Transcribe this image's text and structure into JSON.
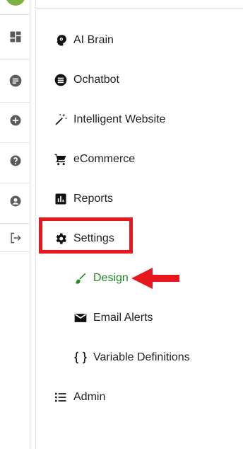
{
  "rail": {
    "items": [
      {
        "icon": "dashboard-icon"
      },
      {
        "icon": "chat-icon"
      },
      {
        "icon": "add-circle-icon"
      },
      {
        "icon": "help-icon"
      },
      {
        "icon": "account-icon"
      },
      {
        "icon": "logout-icon"
      }
    ],
    "logo_color": "#7cb342"
  },
  "menu": {
    "items": [
      {
        "label": "AI Brain",
        "icon": "brain-icon"
      },
      {
        "label": "Ochatbot",
        "icon": "chatbot-icon"
      },
      {
        "label": "Intelligent Website",
        "icon": "magic-wand-icon"
      },
      {
        "label": "eCommerce",
        "icon": "cart-icon"
      },
      {
        "label": "Reports",
        "icon": "bar-chart-icon"
      },
      {
        "label": "Settings",
        "icon": "gear-icon"
      },
      {
        "label": "Design",
        "icon": "brush-icon",
        "active": true
      },
      {
        "label": "Email Alerts",
        "icon": "envelope-icon"
      },
      {
        "label": "Variable Definitions",
        "icon": "curly-braces-icon"
      },
      {
        "label": "Admin",
        "icon": "list-icon"
      }
    ]
  },
  "annotation": {
    "highlight_color": "#e8161d",
    "active_color": "#1e8a1e"
  }
}
